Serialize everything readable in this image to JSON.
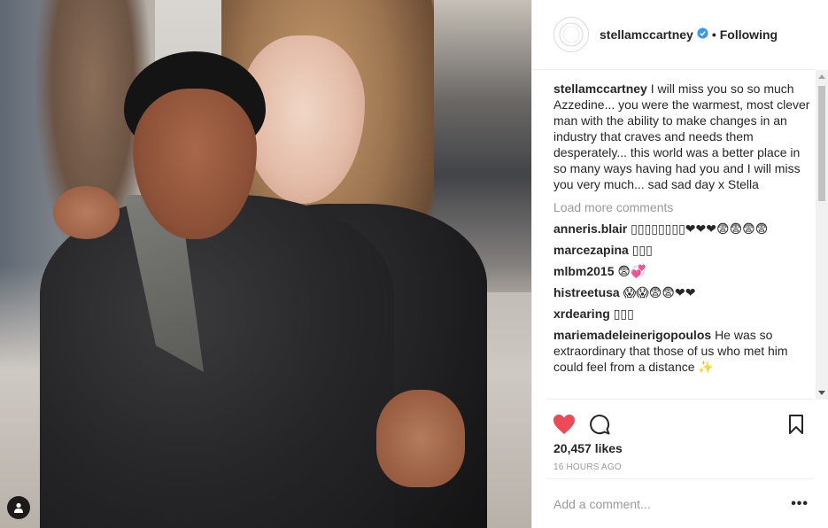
{
  "post": {
    "username": "stellamccartney",
    "verified": true,
    "separator": "•",
    "follow_status": "Following",
    "avatar_text": "STELLA McCARTNEY",
    "caption": {
      "username": "stellamccartney",
      "text": "I will miss you so so much Azzedine... you were the warmest, most clever man with the ability to make changes in an industry that craves and needs them desperately... this world was a better place in so many ways having had you and I will miss you very much... sad sad day x Stella"
    },
    "load_more": "Load more comments",
    "comments": [
      {
        "username": "anneris.blair",
        "text": "▯▯▯▯▯▯▯▯❤❤❤😨😨😨😨"
      },
      {
        "username": "marcezapina",
        "text": "▯▯▯"
      },
      {
        "username": "mlbm2015",
        "text": "😨💞"
      },
      {
        "username": "histreetusa",
        "text": "😱😱😨😨❤❤"
      },
      {
        "username": "xrdearing",
        "text": "▯▯▯"
      },
      {
        "username": "mariemadeleinerigopoulos",
        "text": "He was so extraordinary that those of us who met him could feel from a distance ✨"
      }
    ],
    "likes": "20,457 likes",
    "time_ago": "16 HOURS AGO",
    "add_comment_placeholder": "Add a comment...",
    "more_label": "•••"
  },
  "icons": {
    "like": "heart-icon",
    "comment": "comment-icon",
    "save": "bookmark-icon",
    "user_tag": "person-icon",
    "verified": "verified-badge-icon"
  },
  "colors": {
    "like_red": "#ed4956",
    "verified_blue": "#3897f0",
    "muted_gray": "#999999",
    "text": "#262626"
  }
}
